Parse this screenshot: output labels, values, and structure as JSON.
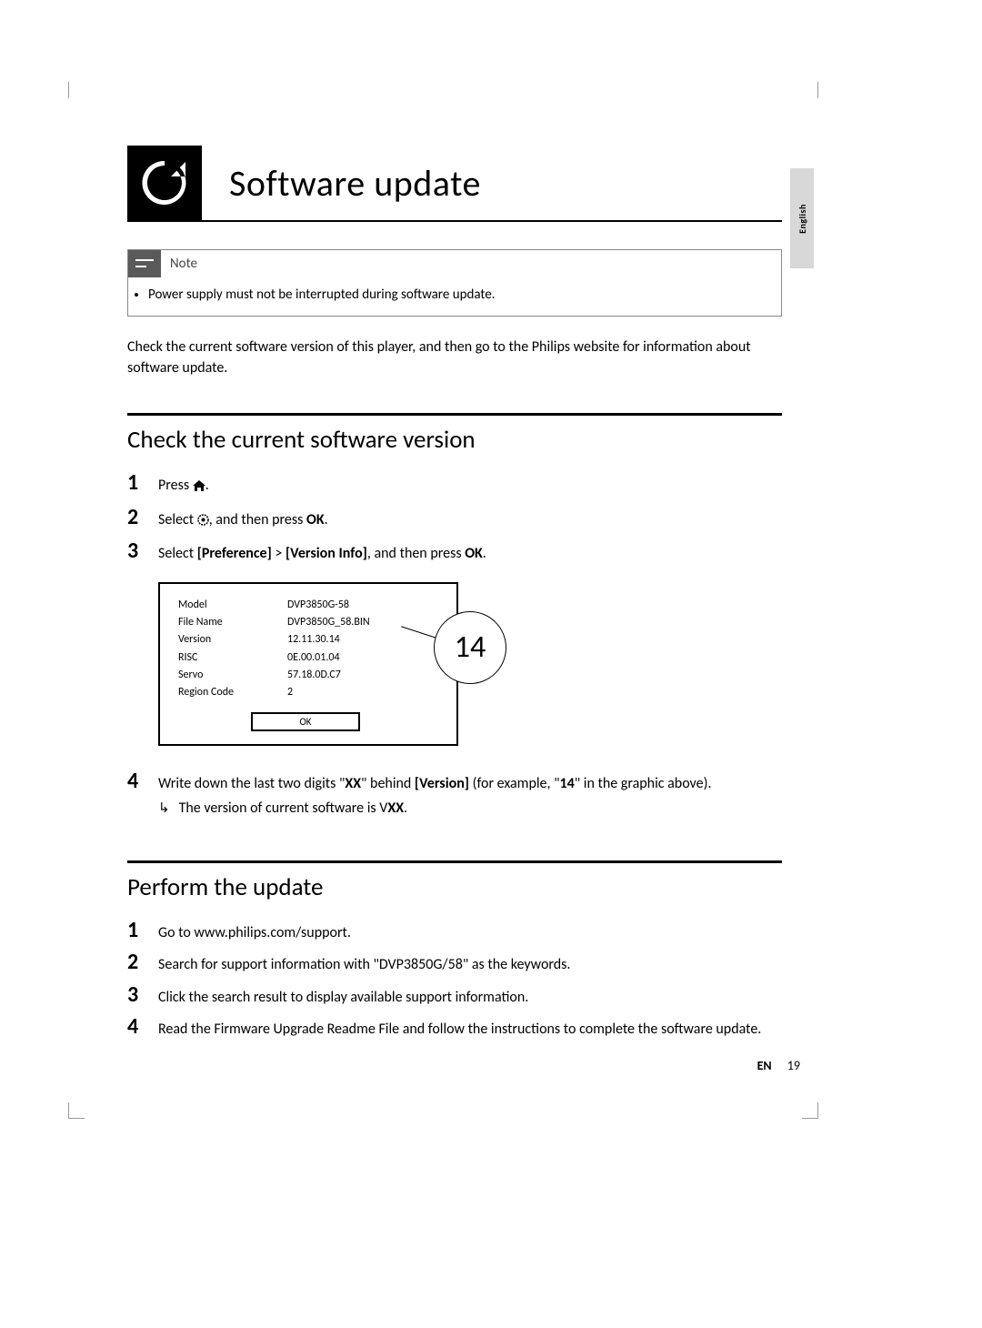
{
  "side_tab": "English",
  "page_title": "Software update",
  "note": {
    "label": "Note",
    "text": "Power supply must not be interrupted during software update."
  },
  "intro": "Check the current software version of this player, and then go to the Philips website for information about software update.",
  "section1": {
    "heading": "Check the current software version",
    "step1_a": "Press ",
    "step1_b": ".",
    "step2_a": "Select ",
    "step2_b": ", and then press ",
    "step2_ok": "OK",
    "step2_c": ".",
    "step3_a": "Select ",
    "step3_pref": "[Preference]",
    "step3_gt": " > ",
    "step3_ver": "[Version Info]",
    "step3_b": ", and then press ",
    "step3_ok": "OK",
    "step3_c": ".",
    "info": {
      "labels": {
        "model": "Model",
        "file": "File Name",
        "version": "Version",
        "risc": "RISC",
        "servo": "Servo",
        "region": "Region Code"
      },
      "values": {
        "model": "DVP3850G-58",
        "file": "DVP3850G_58.BIN",
        "version": "12.11.30.14",
        "risc": "0E.00.01.04",
        "servo": "57.18.0D.C7",
        "region": "2"
      },
      "ok": "OK",
      "callout": "14"
    },
    "step4_a": "Write down the last two digits \"",
    "step4_xx1": "XX",
    "step4_b": "\" behind ",
    "step4_ver": "[Version]",
    "step4_c": " (for example, \"",
    "step4_ex": "14",
    "step4_d": "\" in the graphic above).",
    "sub_a": "The version of current software is V",
    "sub_xx": "XX",
    "sub_b": "."
  },
  "section2": {
    "heading": "Perform the update",
    "step1": "Go to www.philips.com/support.",
    "step2": "Search for support information with \"DVP3850G/58\" as the keywords.",
    "step3": "Click the search result to display available support information.",
    "step4": "Read the Firmware Upgrade Readme File and follow the instructions to complete the software update."
  },
  "footer": {
    "lang": "EN",
    "page": "19"
  },
  "nums": {
    "n1": "1",
    "n2": "2",
    "n3": "3",
    "n4": "4"
  }
}
